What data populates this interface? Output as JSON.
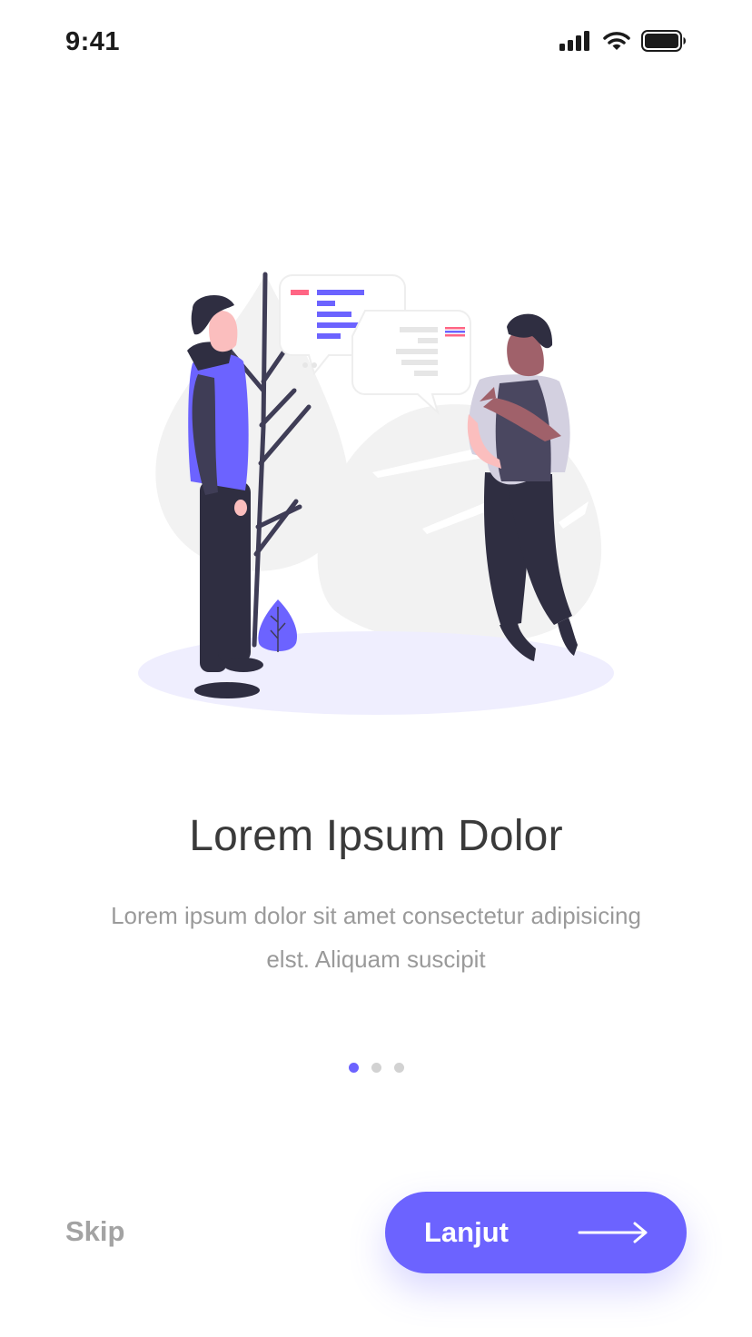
{
  "status_bar": {
    "time": "9:41",
    "icons": [
      "signal-icon",
      "wifi-icon",
      "battery-icon"
    ]
  },
  "illustration": {
    "name": "two-people-chatting-illustration",
    "colors": {
      "accent": "#6c63ff",
      "dark": "#2f2e41",
      "skin_light": "#fbbebe",
      "skin_dark": "#a0616a",
      "light_gray": "#f2f2f2",
      "ground": "#efeefe"
    }
  },
  "onboarding": {
    "title": "Lorem Ipsum Dolor",
    "subtitle": "Lorem ipsum dolor sit amet consectetur adipisicing elst. Aliquam suscipit",
    "pager": {
      "count": 3,
      "active_index": 0
    }
  },
  "actions": {
    "skip_label": "Skip",
    "next_label": "Lanjut"
  },
  "colors": {
    "accent": "#6c63ff",
    "title": "#3a3a3a",
    "subtitle": "#9a9a9a",
    "skip": "#a3a3a3"
  }
}
